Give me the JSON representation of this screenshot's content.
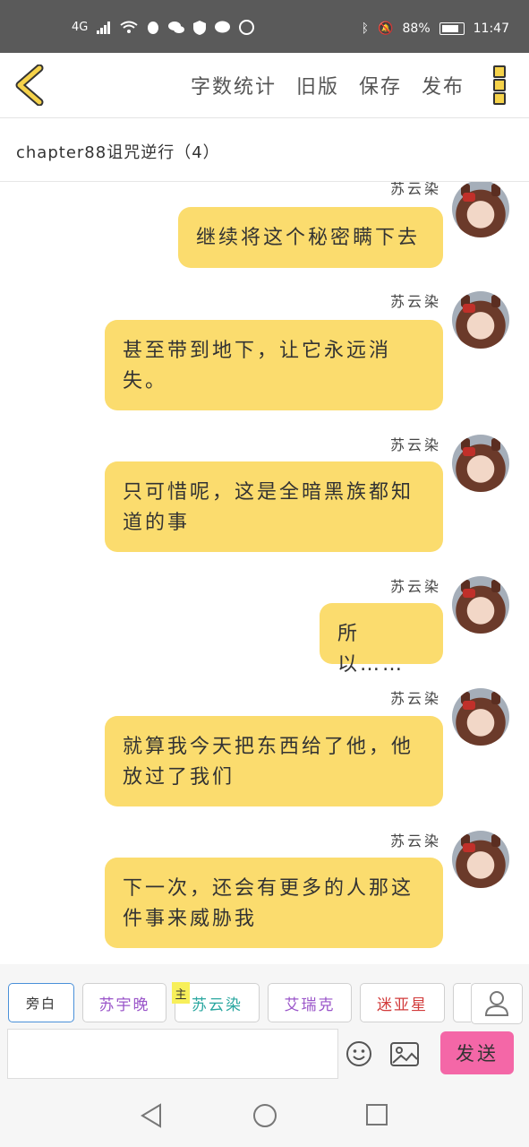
{
  "status": {
    "network": "4G",
    "battery_pct": "88%",
    "time": "11:47"
  },
  "toolbar": {
    "items": [
      "字数统计",
      "旧版",
      "保存",
      "发布"
    ]
  },
  "chapter_title": "chapter88诅咒逆行（4）",
  "messages": [
    {
      "sender": "苏云染",
      "text": "继续将这个秘密瞒下去"
    },
    {
      "sender": "苏云染",
      "text": "甚至带到地下，让它永远消失。"
    },
    {
      "sender": "苏云染",
      "text": "只可惜呢，这是全暗黑族都知道的事"
    },
    {
      "sender": "苏云染",
      "text": "所以……"
    },
    {
      "sender": "苏云染",
      "text": "就算我今天把东西给了他，他放过了我们"
    },
    {
      "sender": "苏云染",
      "text": "下一次，还会有更多的人那这件事来威胁我"
    }
  ],
  "characters": [
    {
      "label": "旁白",
      "color": "#333333"
    },
    {
      "label": "苏宇晚",
      "color": "#9a55c9"
    },
    {
      "label": "苏云染",
      "color": "#2aa7a0"
    },
    {
      "label": "艾瑞克",
      "color": "#9a55c9"
    },
    {
      "label": "迷亚星",
      "color": "#d23c3c"
    }
  ],
  "main_tag": "主",
  "input": {
    "placeholder": ""
  },
  "send_label": "发送"
}
